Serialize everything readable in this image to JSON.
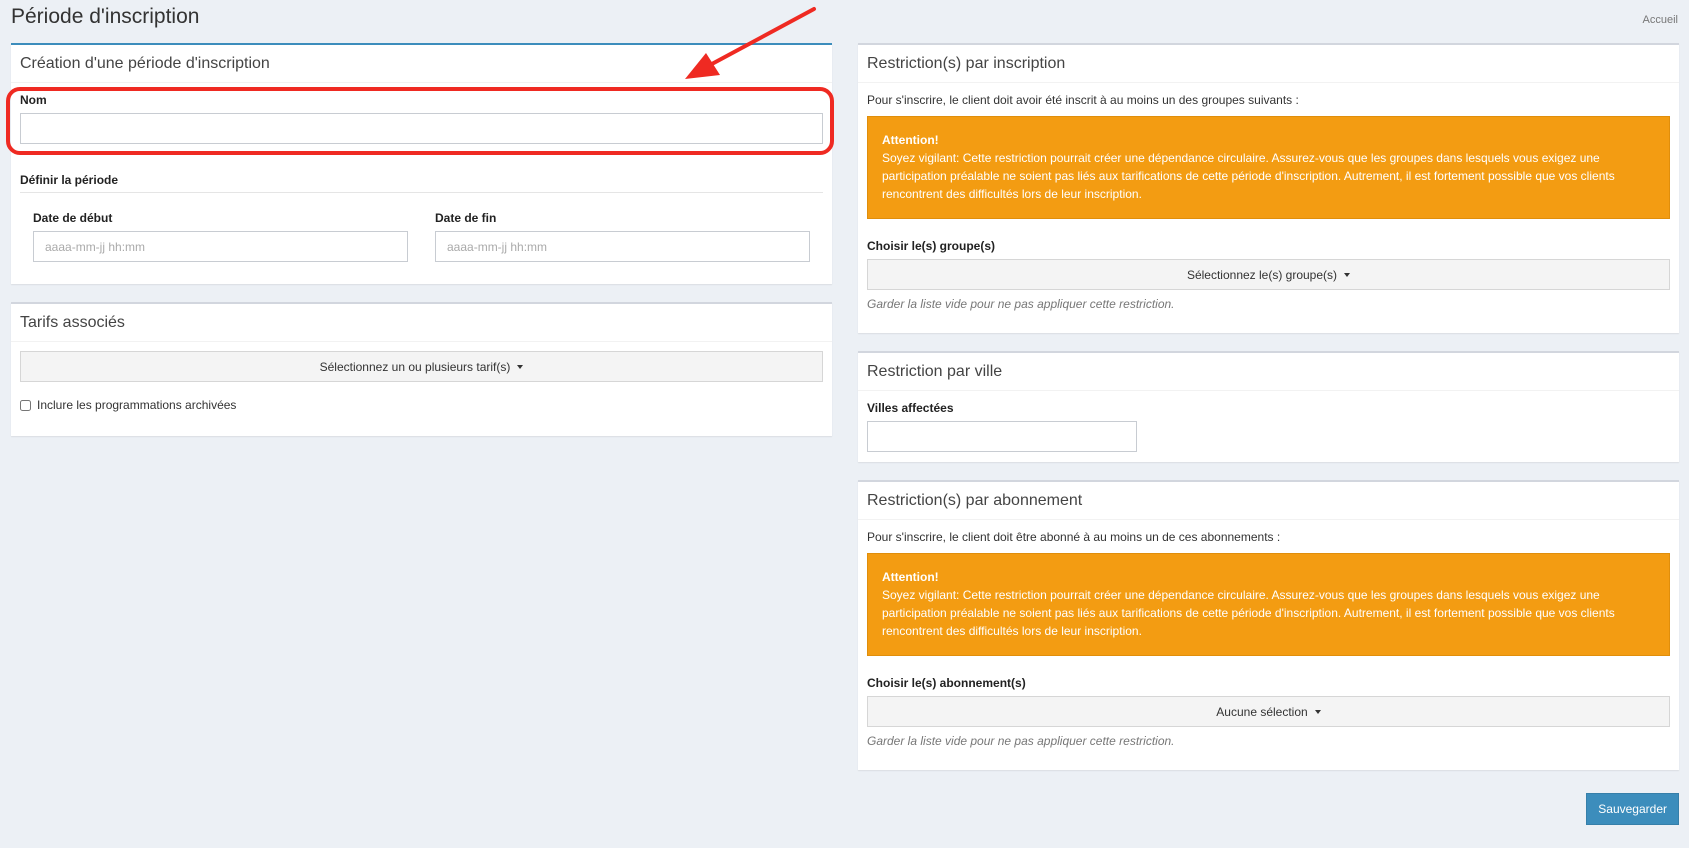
{
  "page": {
    "title": "Période d'inscription",
    "breadcrumb": "Accueil"
  },
  "creation": {
    "title": "Création d'une période d'inscription",
    "name_label": "Nom",
    "name_value": "",
    "period_title": "Définir la période",
    "start_label": "Date de début",
    "start_placeholder": "aaaa-mm-jj hh:mm",
    "end_label": "Date de fin",
    "end_placeholder": "aaaa-mm-jj hh:mm"
  },
  "tarifs": {
    "title": "Tarifs associés",
    "select_label": "Sélectionnez un ou plusieurs tarif(s)",
    "archived_label": "Inclure les programmations archivées",
    "archived_checked": false
  },
  "restriction_inscription": {
    "title": "Restriction(s) par inscription",
    "intro": "Pour s'inscrire, le client doit avoir été inscrit à au moins un des groupes suivants :",
    "alert_title": "Attention!",
    "alert_text": "Soyez vigilant: Cette restriction pourrait créer une dépendance circulaire. Assurez-vous que les groupes dans lesquels vous exigez une participation préalable ne soient pas liés aux tarifications de cette période d'inscription. Autrement, il est fortement possible que vos clients rencontrent des difficultés lors de leur inscription.",
    "choose_label": "Choisir le(s) groupe(s)",
    "select_label": "Sélectionnez le(s) groupe(s)",
    "help": "Garder la liste vide pour ne pas appliquer cette restriction."
  },
  "restriction_ville": {
    "title": "Restriction par ville",
    "label": "Villes affectées",
    "value": ""
  },
  "restriction_abonnement": {
    "title": "Restriction(s) par abonnement",
    "intro": "Pour s'inscrire, le client doit être abonné à au moins un de ces abonnements :",
    "alert_title": "Attention!",
    "alert_text": "Soyez vigilant: Cette restriction pourrait créer une dépendance circulaire. Assurez-vous que les groupes dans lesquels vous exigez une participation préalable ne soient pas liés aux tarifications de cette période d'inscription. Autrement, il est fortement possible que vos clients rencontrent des difficultés lors de leur inscription.",
    "choose_label": "Choisir le(s) abonnement(s)",
    "select_label": "Aucune sélection",
    "help": "Garder la liste vide pour ne pas appliquer cette restriction."
  },
  "actions": {
    "save_label": "Sauvegarder"
  },
  "colors": {
    "primary": "#3c8dbc",
    "warning": "#f39c12",
    "annotation": "#ef2a22",
    "background": "#ecf0f5"
  }
}
